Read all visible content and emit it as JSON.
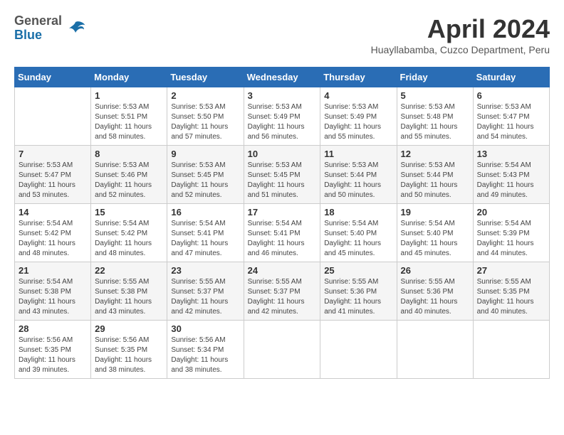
{
  "logo": {
    "general": "General",
    "blue": "Blue"
  },
  "title": "April 2024",
  "location": "Huayllabamba, Cuzco Department, Peru",
  "days_of_week": [
    "Sunday",
    "Monday",
    "Tuesday",
    "Wednesday",
    "Thursday",
    "Friday",
    "Saturday"
  ],
  "weeks": [
    [
      {
        "day": "",
        "info": ""
      },
      {
        "day": "1",
        "info": "Sunrise: 5:53 AM\nSunset: 5:51 PM\nDaylight: 11 hours\nand 58 minutes."
      },
      {
        "day": "2",
        "info": "Sunrise: 5:53 AM\nSunset: 5:50 PM\nDaylight: 11 hours\nand 57 minutes."
      },
      {
        "day": "3",
        "info": "Sunrise: 5:53 AM\nSunset: 5:49 PM\nDaylight: 11 hours\nand 56 minutes."
      },
      {
        "day": "4",
        "info": "Sunrise: 5:53 AM\nSunset: 5:49 PM\nDaylight: 11 hours\nand 55 minutes."
      },
      {
        "day": "5",
        "info": "Sunrise: 5:53 AM\nSunset: 5:48 PM\nDaylight: 11 hours\nand 55 minutes."
      },
      {
        "day": "6",
        "info": "Sunrise: 5:53 AM\nSunset: 5:47 PM\nDaylight: 11 hours\nand 54 minutes."
      }
    ],
    [
      {
        "day": "7",
        "info": "Sunrise: 5:53 AM\nSunset: 5:47 PM\nDaylight: 11 hours\nand 53 minutes."
      },
      {
        "day": "8",
        "info": "Sunrise: 5:53 AM\nSunset: 5:46 PM\nDaylight: 11 hours\nand 52 minutes."
      },
      {
        "day": "9",
        "info": "Sunrise: 5:53 AM\nSunset: 5:45 PM\nDaylight: 11 hours\nand 52 minutes."
      },
      {
        "day": "10",
        "info": "Sunrise: 5:53 AM\nSunset: 5:45 PM\nDaylight: 11 hours\nand 51 minutes."
      },
      {
        "day": "11",
        "info": "Sunrise: 5:53 AM\nSunset: 5:44 PM\nDaylight: 11 hours\nand 50 minutes."
      },
      {
        "day": "12",
        "info": "Sunrise: 5:53 AM\nSunset: 5:44 PM\nDaylight: 11 hours\nand 50 minutes."
      },
      {
        "day": "13",
        "info": "Sunrise: 5:54 AM\nSunset: 5:43 PM\nDaylight: 11 hours\nand 49 minutes."
      }
    ],
    [
      {
        "day": "14",
        "info": "Sunrise: 5:54 AM\nSunset: 5:42 PM\nDaylight: 11 hours\nand 48 minutes."
      },
      {
        "day": "15",
        "info": "Sunrise: 5:54 AM\nSunset: 5:42 PM\nDaylight: 11 hours\nand 48 minutes."
      },
      {
        "day": "16",
        "info": "Sunrise: 5:54 AM\nSunset: 5:41 PM\nDaylight: 11 hours\nand 47 minutes."
      },
      {
        "day": "17",
        "info": "Sunrise: 5:54 AM\nSunset: 5:41 PM\nDaylight: 11 hours\nand 46 minutes."
      },
      {
        "day": "18",
        "info": "Sunrise: 5:54 AM\nSunset: 5:40 PM\nDaylight: 11 hours\nand 45 minutes."
      },
      {
        "day": "19",
        "info": "Sunrise: 5:54 AM\nSunset: 5:40 PM\nDaylight: 11 hours\nand 45 minutes."
      },
      {
        "day": "20",
        "info": "Sunrise: 5:54 AM\nSunset: 5:39 PM\nDaylight: 11 hours\nand 44 minutes."
      }
    ],
    [
      {
        "day": "21",
        "info": "Sunrise: 5:54 AM\nSunset: 5:38 PM\nDaylight: 11 hours\nand 43 minutes."
      },
      {
        "day": "22",
        "info": "Sunrise: 5:55 AM\nSunset: 5:38 PM\nDaylight: 11 hours\nand 43 minutes."
      },
      {
        "day": "23",
        "info": "Sunrise: 5:55 AM\nSunset: 5:37 PM\nDaylight: 11 hours\nand 42 minutes."
      },
      {
        "day": "24",
        "info": "Sunrise: 5:55 AM\nSunset: 5:37 PM\nDaylight: 11 hours\nand 42 minutes."
      },
      {
        "day": "25",
        "info": "Sunrise: 5:55 AM\nSunset: 5:36 PM\nDaylight: 11 hours\nand 41 minutes."
      },
      {
        "day": "26",
        "info": "Sunrise: 5:55 AM\nSunset: 5:36 PM\nDaylight: 11 hours\nand 40 minutes."
      },
      {
        "day": "27",
        "info": "Sunrise: 5:55 AM\nSunset: 5:35 PM\nDaylight: 11 hours\nand 40 minutes."
      }
    ],
    [
      {
        "day": "28",
        "info": "Sunrise: 5:56 AM\nSunset: 5:35 PM\nDaylight: 11 hours\nand 39 minutes."
      },
      {
        "day": "29",
        "info": "Sunrise: 5:56 AM\nSunset: 5:35 PM\nDaylight: 11 hours\nand 38 minutes."
      },
      {
        "day": "30",
        "info": "Sunrise: 5:56 AM\nSunset: 5:34 PM\nDaylight: 11 hours\nand 38 minutes."
      },
      {
        "day": "",
        "info": ""
      },
      {
        "day": "",
        "info": ""
      },
      {
        "day": "",
        "info": ""
      },
      {
        "day": "",
        "info": ""
      }
    ]
  ]
}
